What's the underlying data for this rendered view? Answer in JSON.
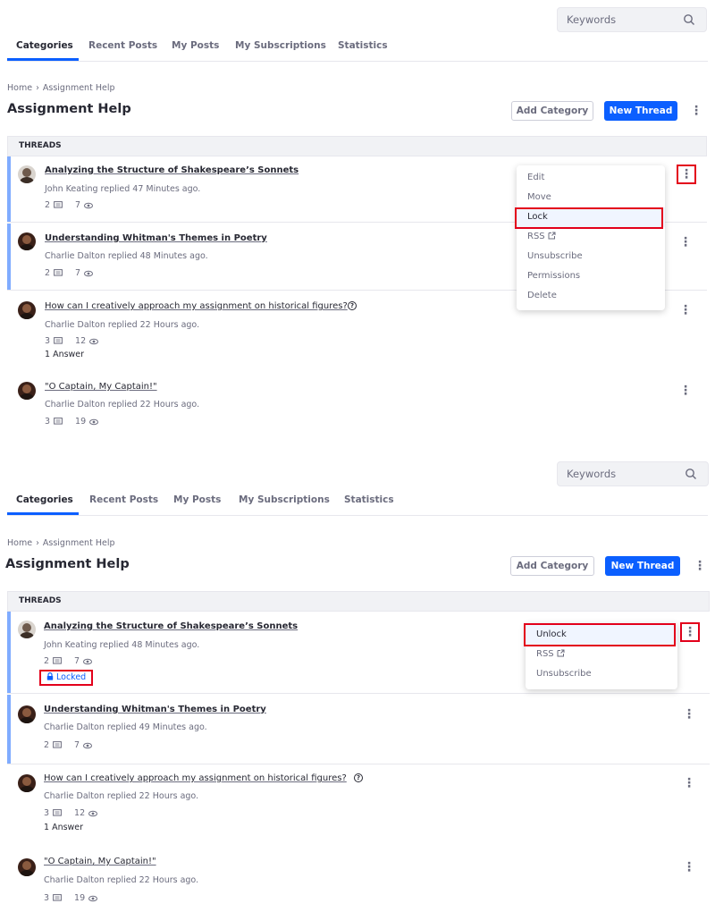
{
  "search": {
    "placeholder": "Keywords",
    "icon": "search-icon"
  },
  "tabs": [
    "Categories",
    "Recent Posts",
    "My Posts",
    "My Subscriptions",
    "Statistics"
  ],
  "breadcrumb": {
    "home": "Home",
    "separator": "›",
    "current": "Assignment Help"
  },
  "page_title": "Assignment Help",
  "buttons": {
    "add_category": "Add Category",
    "new_thread": "New Thread"
  },
  "threads_header": "THREADS",
  "colors": {
    "accent": "#0b5fff",
    "highlight_box": "#e3001b",
    "row_accent": "#80acff"
  },
  "screens": [
    {
      "threads": [
        {
          "title": "Analyzing the Structure of Shakespeare’s Sonnets",
          "meta": "John Keating replied 47 Minutes ago.",
          "replies": "2",
          "views": "7"
        },
        {
          "title": "Understanding Whitman's Themes in Poetry",
          "meta": "Charlie Dalton replied 48 Minutes ago.",
          "replies": "2",
          "views": "7"
        },
        {
          "title": "How can I creatively approach my assignment on historical figures?",
          "meta": "Charlie Dalton replied 22 Hours ago.",
          "replies": "3",
          "views": "12",
          "answers": "1 Answer"
        },
        {
          "title": "\"O Captain, My Captain!\"",
          "meta": "Charlie Dalton replied 22 Hours ago.",
          "replies": "3",
          "views": "19"
        }
      ],
      "menu": [
        "Edit",
        "Move",
        "Lock",
        "RSS",
        "Unsubscribe",
        "Permissions",
        "Delete"
      ]
    },
    {
      "threads": [
        {
          "title": "Analyzing the Structure of Shakespeare’s Sonnets",
          "meta": "John Keating replied 48 Minutes ago.",
          "replies": "2",
          "views": "7",
          "status": "Locked"
        },
        {
          "title": "Understanding Whitman's Themes in Poetry",
          "meta": "Charlie Dalton replied 49 Minutes ago.",
          "replies": "2",
          "views": "7"
        },
        {
          "title": "How can I creatively approach my assignment on historical figures?",
          "meta": "Charlie Dalton replied 22 Hours ago.",
          "replies": "3",
          "views": "12",
          "answers": "1 Answer"
        },
        {
          "title": "\"O Captain, My Captain!\"",
          "meta": "Charlie Dalton replied 22 Hours ago.",
          "replies": "3",
          "views": "19"
        }
      ],
      "menu": [
        "Unlock",
        "RSS",
        "Unsubscribe"
      ]
    }
  ]
}
